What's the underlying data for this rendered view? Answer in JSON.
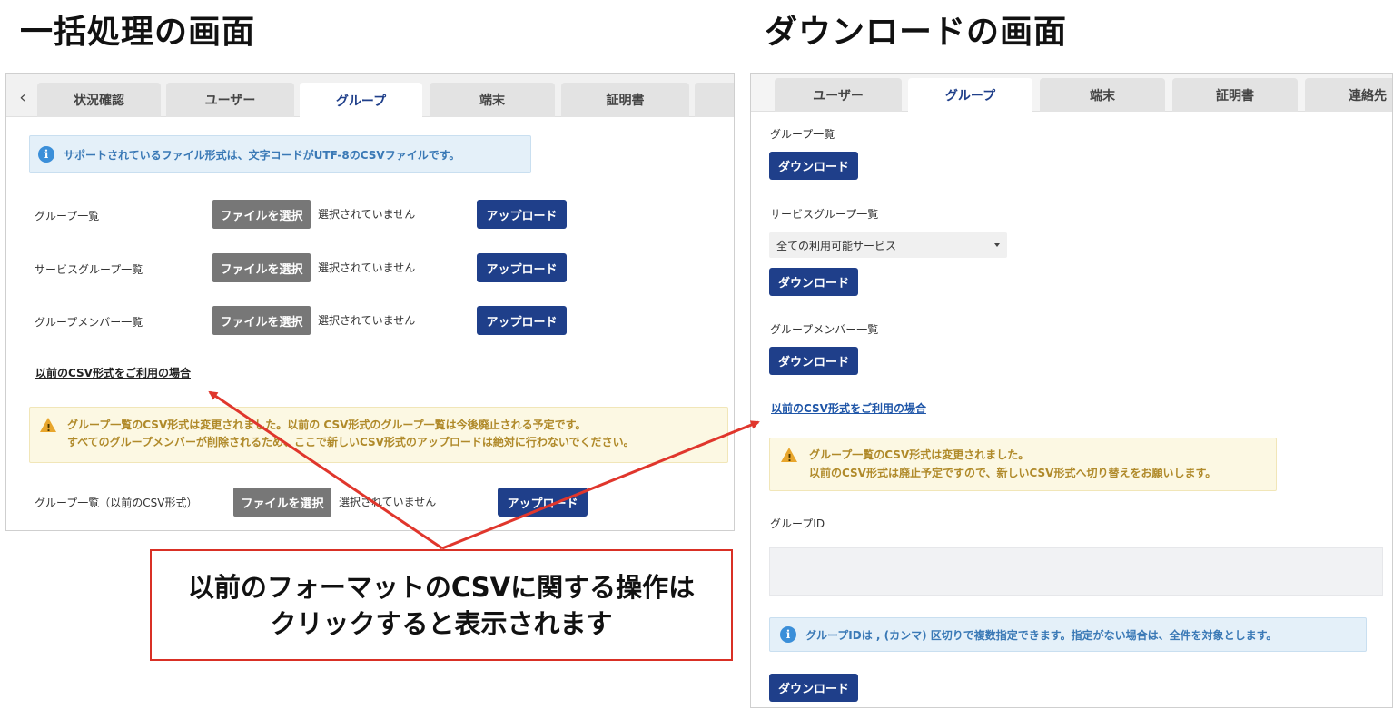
{
  "headings": {
    "left": "一括処理の画面",
    "right": "ダウンロードの画面"
  },
  "left_panel": {
    "tabs": [
      "状況確認",
      "ユーザー",
      "グループ",
      "端末",
      "証明書"
    ],
    "active_tab": "グループ",
    "info": {
      "icon": "info-icon",
      "text": "サポートされているファイル形式は、文字コードがUTF-8のCSVファイルです。"
    },
    "file_button_label": "ファイルを選択",
    "no_file_text": "選択されていません",
    "upload_label": "アップロード",
    "rows": [
      {
        "label": "グループ一覧"
      },
      {
        "label": "サービスグループ一覧"
      },
      {
        "label": "グループメンバー一覧"
      }
    ],
    "legacy_link": "以前のCSV形式をご利用の場合",
    "warning": {
      "icon": "warning-icon",
      "line1": "グループ一覧のCSV形式は変更されました。以前の CSV形式のグループ一覧は今後廃止される予定です。",
      "line2": "すべてのグループメンバーが削除されるため、ここで新しいCSV形式のアップロードは絶対に行わないでください。"
    },
    "legacy_row_label": "グループ一覧（以前のCSV形式）"
  },
  "right_panel": {
    "tabs": [
      "ユーザー",
      "グループ",
      "端末",
      "証明書",
      "連絡先"
    ],
    "active_tab": "グループ",
    "download_label": "ダウンロード",
    "sections": [
      {
        "label": "グループ一覧"
      },
      {
        "label": "サービスグループ一覧"
      },
      {
        "label": "グループメンバー一覧"
      }
    ],
    "select_value": "全ての利用可能サービス",
    "legacy_link": "以前のCSV形式をご利用の場合",
    "warning": {
      "icon": "warning-icon",
      "line1": "グループ一覧のCSV形式は変更されました。",
      "line2": "以前のCSV形式は廃止予定ですので、新しいCSV形式へ切り替えをお願いします。"
    },
    "group_id_label": "グループID",
    "info": {
      "icon": "info-icon",
      "text": "グループIDは , (カンマ) 区切りで複数指定できます。指定がない場合は、全件を対象とします。"
    }
  },
  "callout": {
    "line1": "以前のフォーマットのCSVに関する操作は",
    "line2": "クリックすると表示されます"
  },
  "colors": {
    "primary": "#1f3f8a",
    "file_button": "#777777",
    "info_bg": "#e4f0f9",
    "warn_bg": "#fcf8e3",
    "callout_border": "#d93025",
    "arrow": "#e0362c"
  }
}
